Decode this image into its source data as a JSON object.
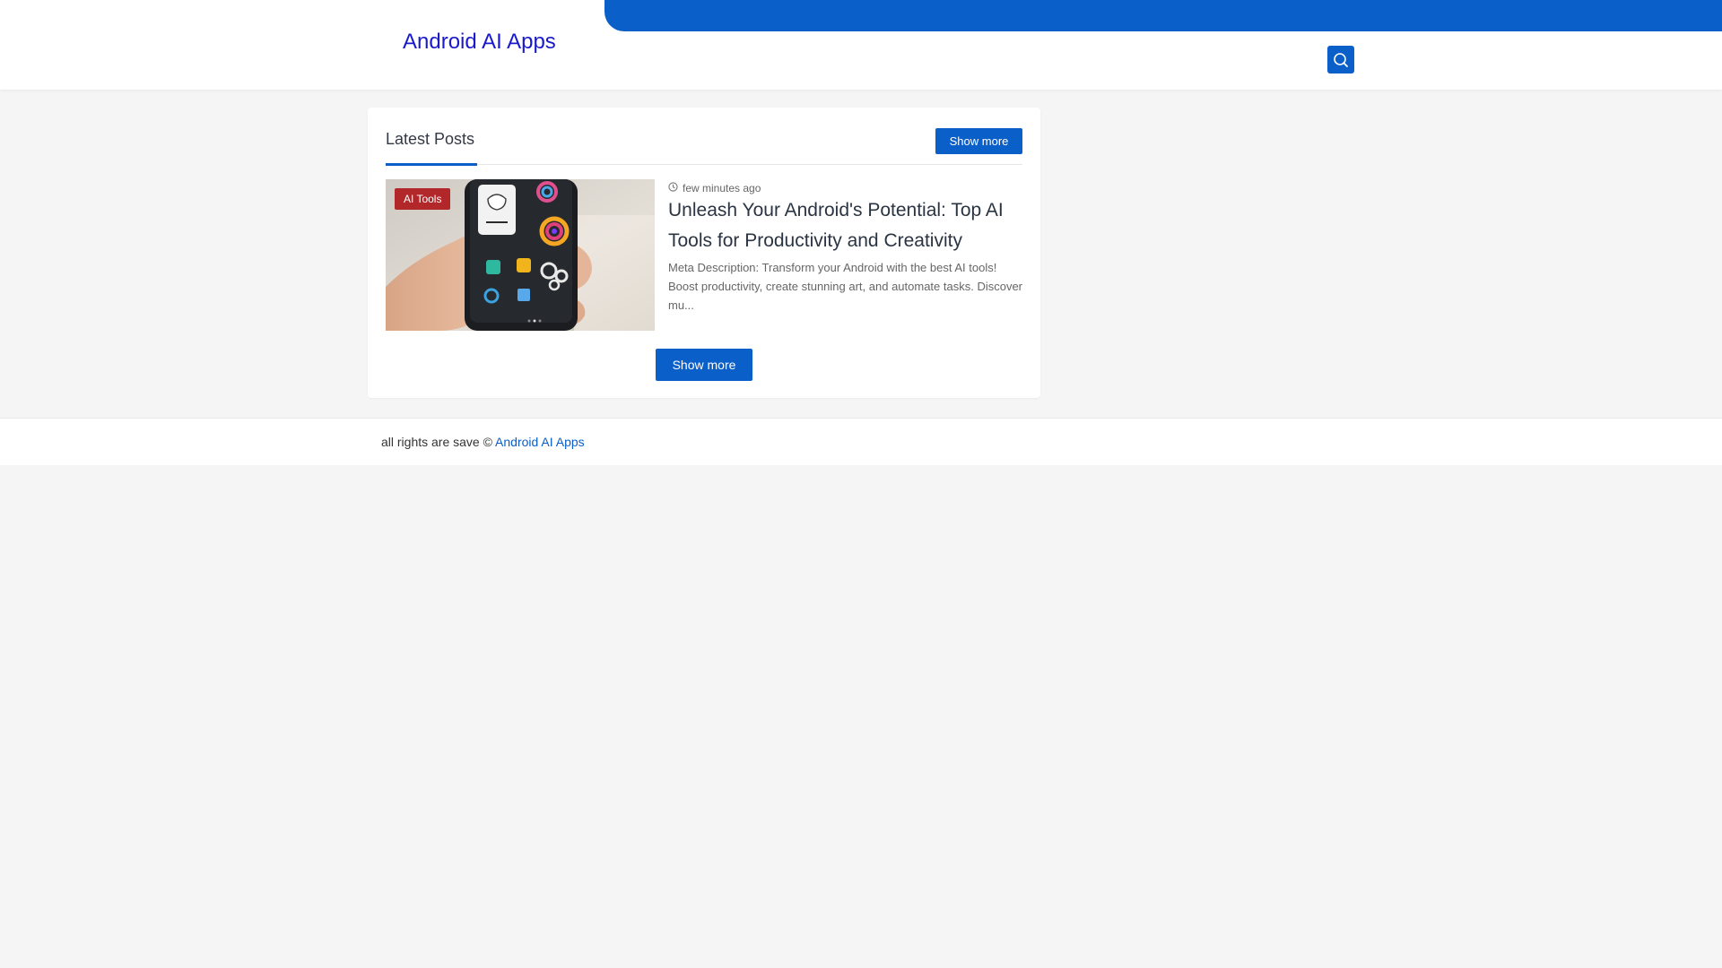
{
  "header": {
    "site_title": "Android AI Apps",
    "search_icon": "search-icon",
    "accent_color": "#0a5fc9"
  },
  "latest_posts": {
    "title": "Latest Posts",
    "show_more_top": "Show more",
    "show_more_bottom": "Show more",
    "posts": [
      {
        "category": "AI Tools",
        "time": "few minutes ago",
        "title": "Unleash Your Android's Potential: Top AI Tools for Productivity and Creativity",
        "excerpt": "  Meta Description: Transform your Android with the best AI tools! Boost productivity, create stunning art, and automate tasks. Discover mu...",
        "badge_color": "#b1272a"
      }
    ]
  },
  "footer": {
    "rights_text": "all rights are save ©",
    "site_link": "Android AI Apps"
  }
}
